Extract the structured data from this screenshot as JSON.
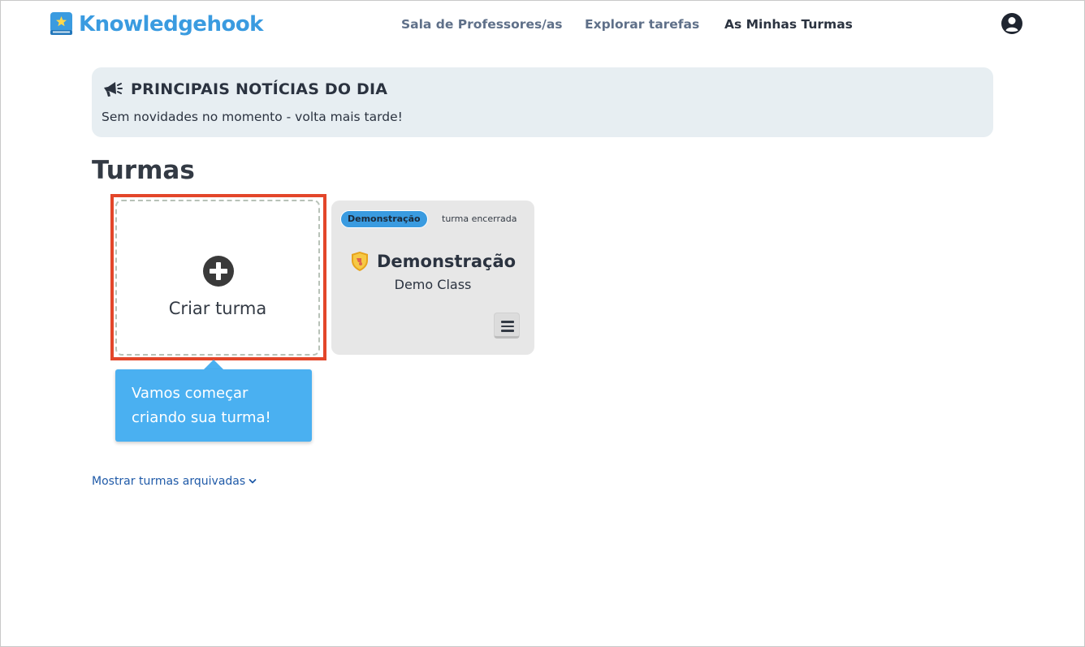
{
  "header": {
    "logo_text": "Knowledgehook",
    "nav": [
      {
        "label": "Sala de Professores/as",
        "active": false
      },
      {
        "label": "Explorar tarefas",
        "active": false
      },
      {
        "label": "As Minhas Turmas",
        "active": true
      }
    ],
    "user_icon": "user-circle-icon"
  },
  "news": {
    "icon": "megaphone-icon",
    "title": "PRINCIPAIS NOTÍCIAS DO DIA",
    "text": "Sem novidades no momento - volta mais tarde!"
  },
  "classes": {
    "title": "Turmas",
    "create_card": {
      "label": "Criar turma",
      "icon": "plus-circle-icon"
    },
    "demo_card": {
      "badge": "Demonstração",
      "status": "turma encerrada",
      "name": "Demonstração",
      "subtitle": "Demo Class",
      "icon": "shield-icon",
      "menu_icon": "hamburger-menu-icon"
    },
    "tooltip": "Vamos começar criando sua turma!",
    "archived_link": "Mostrar turmas arquivadas"
  },
  "colors": {
    "brand": "#3a9be0",
    "highlight": "#e3462a",
    "tooltip": "#4ab0f1",
    "banner_bg": "#e7eef2"
  }
}
